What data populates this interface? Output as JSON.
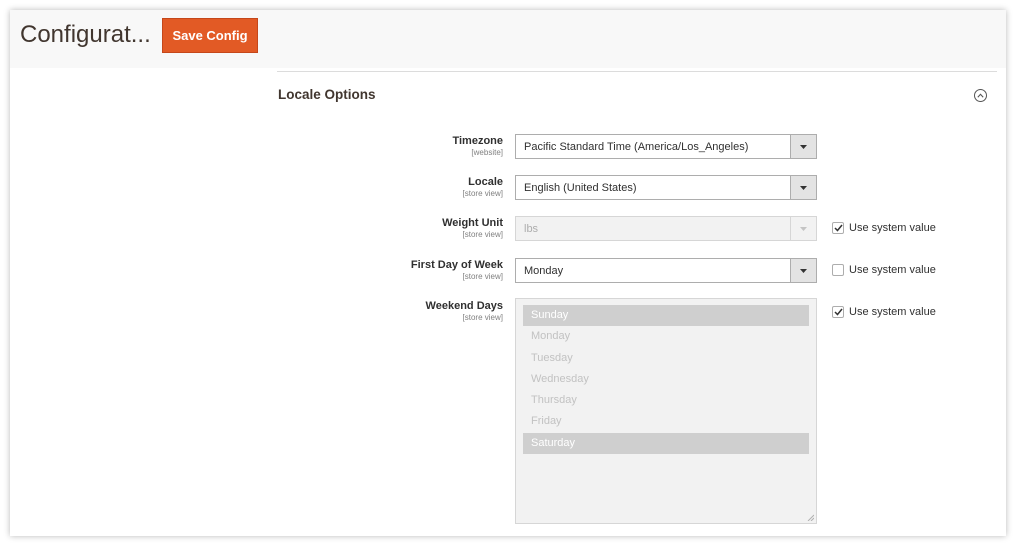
{
  "header": {
    "title": "Configurat...",
    "save_label": "Save Config"
  },
  "section": {
    "title": "Locale Options"
  },
  "fields": {
    "timezone": {
      "label": "Timezone",
      "scope": "[website]",
      "value": "Pacific Standard Time (America/Los_Angeles)"
    },
    "locale": {
      "label": "Locale",
      "scope": "[store view]",
      "value": "English (United States)"
    },
    "weight_unit": {
      "label": "Weight Unit",
      "scope": "[store view]",
      "value": "lbs",
      "disabled": true,
      "use_system_label": "Use system value",
      "use_system_checked": true
    },
    "first_day": {
      "label": "First Day of Week",
      "scope": "[store view]",
      "value": "Monday",
      "use_system_label": "Use system value",
      "use_system_checked": false
    },
    "weekend_days": {
      "label": "Weekend Days",
      "scope": "[store view]",
      "disabled": true,
      "use_system_label": "Use system value",
      "use_system_checked": true,
      "options": [
        {
          "label": "Sunday",
          "selected": true
        },
        {
          "label": "Monday",
          "selected": false
        },
        {
          "label": "Tuesday",
          "selected": false
        },
        {
          "label": "Wednesday",
          "selected": false
        },
        {
          "label": "Thursday",
          "selected": false
        },
        {
          "label": "Friday",
          "selected": false
        },
        {
          "label": "Saturday",
          "selected": true
        }
      ]
    }
  },
  "colors": {
    "accent": "#e25a25",
    "header_bg": "#f8f8f8",
    "text": "#303030"
  },
  "icons": {
    "collapse": "chevron-up-circle-icon",
    "dropdown": "caret-down-icon",
    "check": "checkmark-icon"
  }
}
